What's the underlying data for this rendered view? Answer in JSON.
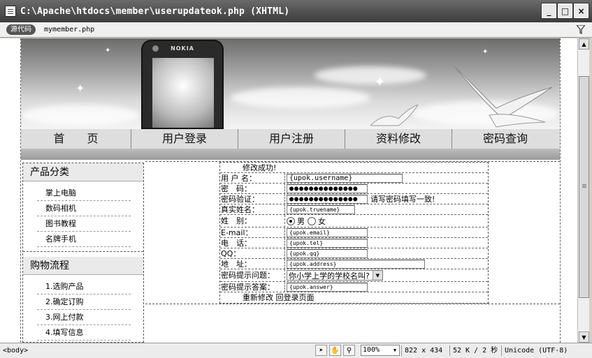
{
  "window": {
    "title": "C:\\Apache\\htdocs\\member\\userupdateok.php (XHTML)",
    "controls": [
      "_",
      "□",
      "×"
    ]
  },
  "files_bar": {
    "source_label": "源代码",
    "file": "mymember.php"
  },
  "banner": {
    "phone_brand": "NOKIA"
  },
  "nav": {
    "items": [
      "首　　页",
      "用户登录",
      "用户注册",
      "资料修改",
      "密码查询"
    ]
  },
  "sidebar": {
    "section1_title": "产品分类",
    "section1_items": [
      "掌上电脑",
      "数码相机",
      "图书教程",
      "名牌手机"
    ],
    "section2_title": "购物流程",
    "section2_items": [
      "1.选购产品",
      "2.确定订购",
      "3.网上付款",
      "4.填写信息"
    ]
  },
  "form": {
    "success_msg": "修改成功!",
    "username_label": "用 户 名：",
    "username_value": "{upok.username}",
    "password_label": "密　码：",
    "password_value": "●●●●●●●●●●●●●●",
    "confirm_label": "密码验证：",
    "confirm_value": "●●●●●●●●●●●●●●",
    "confirm_hint": "请写密码填写一致!",
    "realname_label": "真实姓名：",
    "realname_value": "{upok.truename}",
    "gender_label": "姓　别：",
    "gender_male": "男",
    "gender_female": "女",
    "email_label": "E-mail：",
    "email_value": "{upok.email}",
    "phone_label": "电　话：",
    "phone_value": "{upok.tel}",
    "qq_label": "QQ：",
    "qq_value": "{upok.qq}",
    "address_label": "地　址：",
    "address_value": "{upok.address}",
    "question_label": "密码提示问题：",
    "question_value": "你小学上学的学校名叫?",
    "answer_label": "密码提示答案：",
    "answer_value": "{upok.answer}",
    "footer_links": "重新修改 回登录页面"
  },
  "status": {
    "tag": "<body>",
    "zoom": "100%",
    "size": "822 x 434",
    "filesize": "52 K / 2 秒",
    "encoding": "Unicode (UTF-8)"
  }
}
